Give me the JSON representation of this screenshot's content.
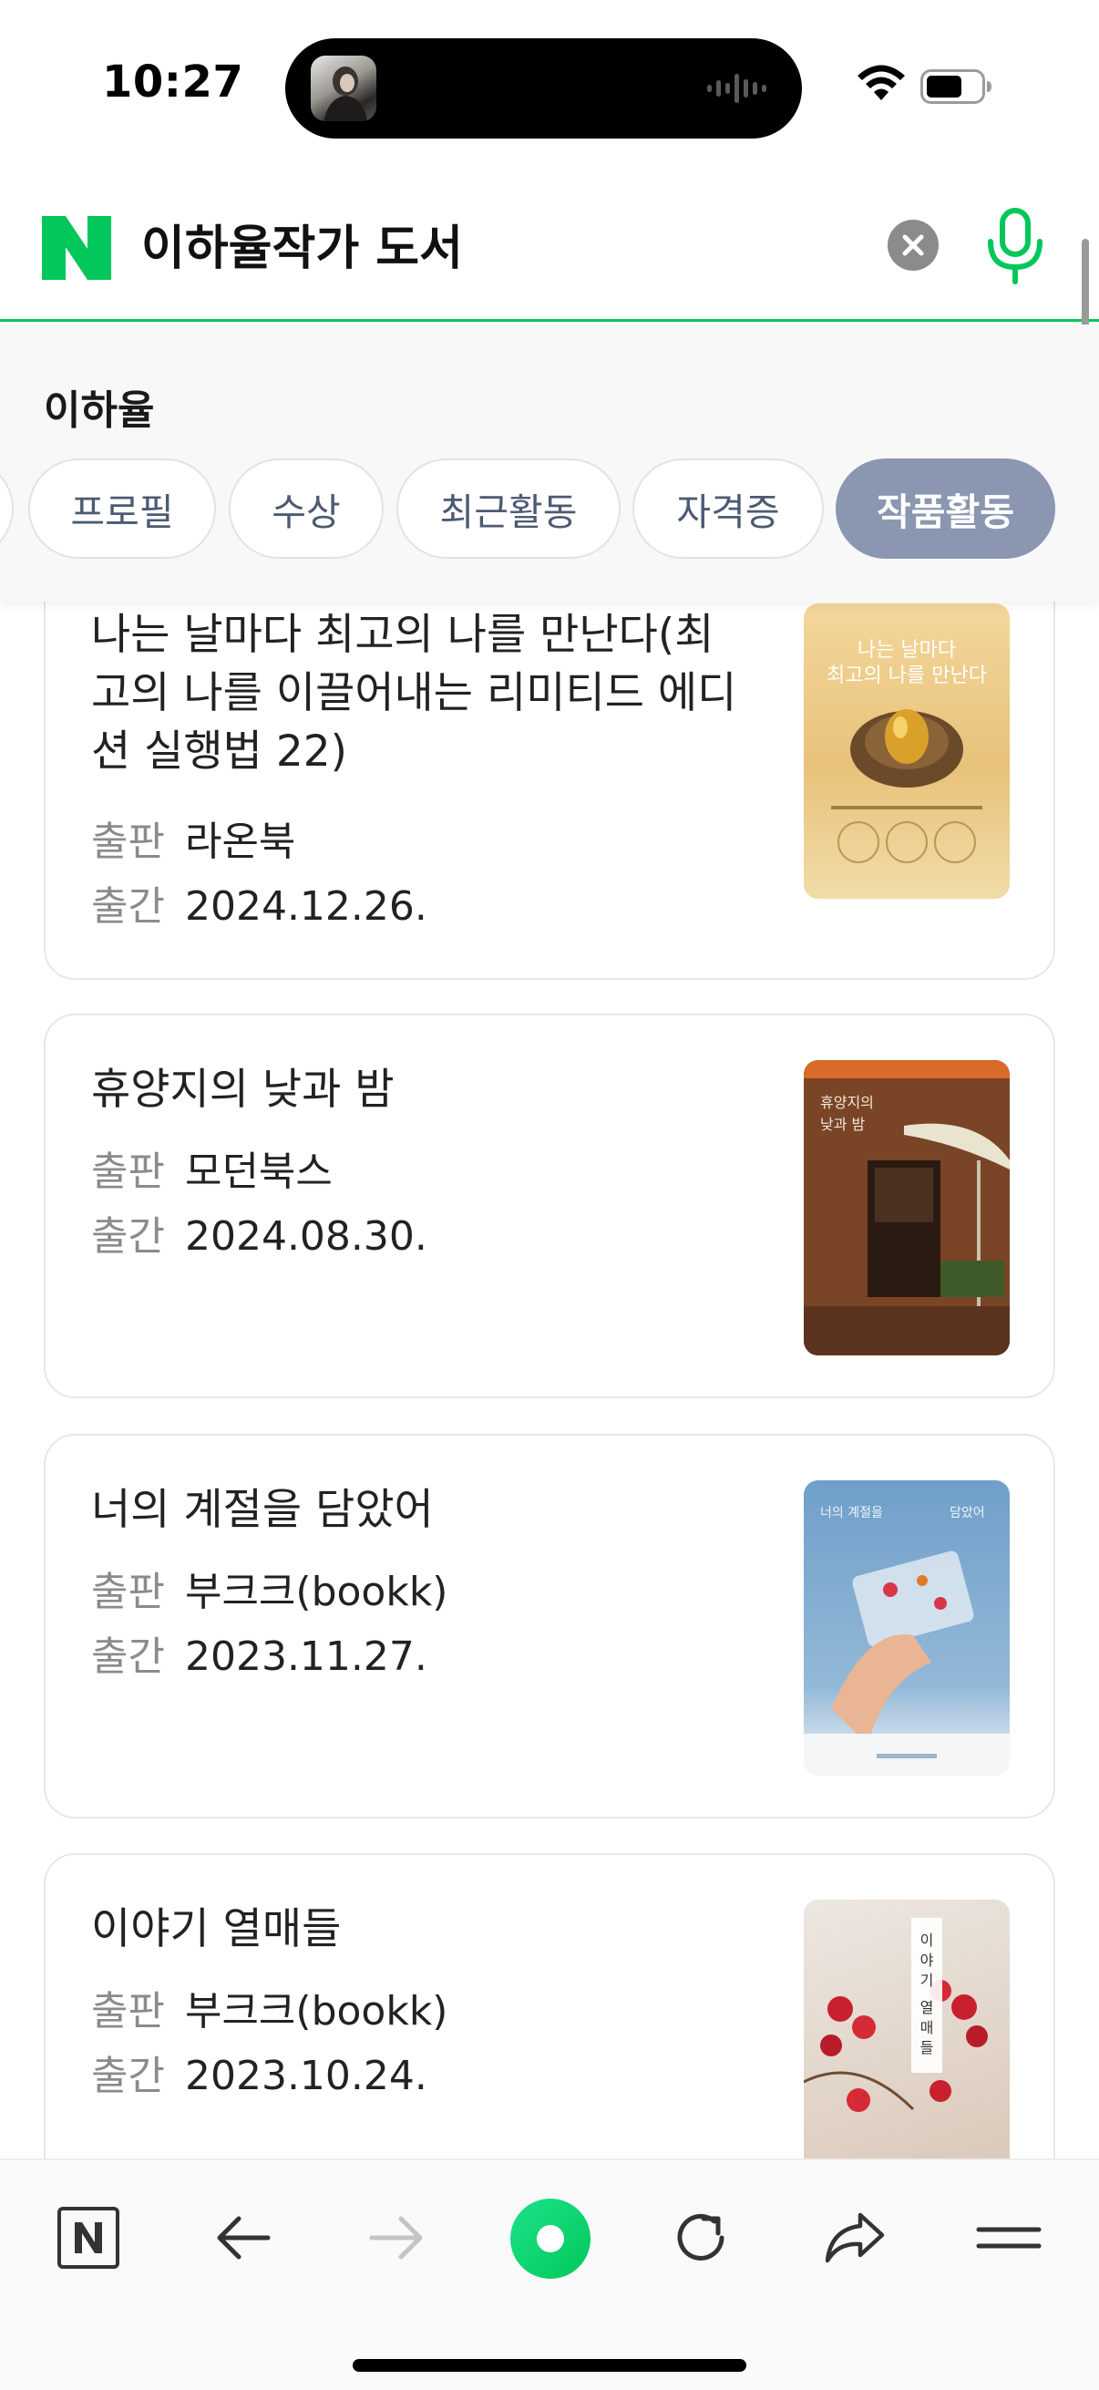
{
  "status_bar": {
    "time": "10:27",
    "icons": [
      "now-playing-thumbnail",
      "audio-wave-icon",
      "wifi-icon",
      "battery-icon"
    ]
  },
  "search": {
    "logo": "N",
    "query": "이하율작가 도서",
    "icons": [
      "clear-icon",
      "microphone-icon"
    ]
  },
  "entity": {
    "name": "이하율",
    "tabs": [
      {
        "label": ""
      },
      {
        "label": "프로필"
      },
      {
        "label": "수상"
      },
      {
        "label": "최근활동"
      },
      {
        "label": "자격증"
      },
      {
        "label": "작품활동",
        "selected": true
      }
    ]
  },
  "books": [
    {
      "title": "나는 날마다 최고의 나를 만난다(최고의 나를 이끌어내는 리미티드 에디션 실행법 22)",
      "title_lines": [
        "나는 날마다 최고의 나를 만난다(최",
        "고의 나를 이끌어내는 리미티드 에디",
        "션 실행법 22)"
      ],
      "publisher_label": "출판",
      "publisher": "라온북",
      "date_label": "출간",
      "date": "2024.12.26.",
      "cover_text": "나는 날마다\n최고의 나를 만난다"
    },
    {
      "title": "휴양지의 낮과 밤",
      "publisher_label": "출판",
      "publisher": "모던북스",
      "date_label": "출간",
      "date": "2024.08.30.",
      "cover_text": "휴양지의\n낮과 밤"
    },
    {
      "title": "너의 계절을 담았어",
      "publisher_label": "출판",
      "publisher": "부크크(bookk)",
      "date_label": "출간",
      "date": "2023.11.27.",
      "cover_text": "너의 계절을 담았어"
    },
    {
      "title": "이야기 열매들",
      "publisher_label": "출판",
      "publisher": "부크크(bookk)",
      "date_label": "출간",
      "date": "2023.10.24.",
      "cover_text": "이야기 열매들"
    }
  ],
  "toolbar": {
    "items": [
      "naver-home-icon",
      "back-arrow-icon",
      "forward-arrow-icon",
      "green-dot-icon",
      "reload-icon",
      "share-icon",
      "menu-icon"
    ]
  },
  "colors": {
    "naver_green": "#03c75a",
    "active_tab": "#8b96b1",
    "tab_text": "#4c5a73",
    "meta_label": "#8b8b8b"
  }
}
